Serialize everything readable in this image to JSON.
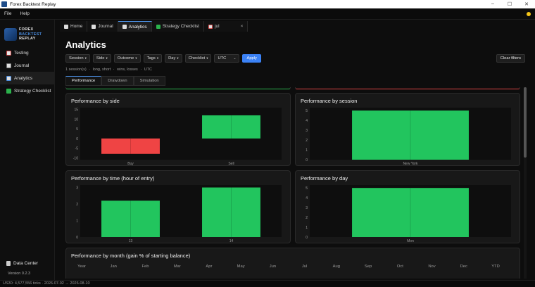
{
  "window": {
    "title": "Forex Backtest Replay",
    "controls": [
      "–",
      "☐",
      "✕"
    ]
  },
  "menu": {
    "items": [
      "File",
      "Help"
    ]
  },
  "brand": {
    "line1": "FOREX",
    "line2": "BACKTEST",
    "line3": "REPLAY"
  },
  "sidebar": {
    "items": [
      {
        "label": "Testing",
        "icon": "testing-icon"
      },
      {
        "label": "Journal",
        "icon": "journal-icon"
      },
      {
        "label": "Analytics",
        "icon": "analytics-icon",
        "active": true
      },
      {
        "label": "Strategy  Checklist",
        "icon": "checklist-icon"
      }
    ],
    "data_center": "Data Center",
    "version": "Version 0.2.3"
  },
  "tabs": [
    {
      "label": "Home",
      "icon": "home-icon"
    },
    {
      "label": "Journal",
      "icon": "journal-icon"
    },
    {
      "label": "Analytics",
      "icon": "analytics-icon",
      "active": true
    },
    {
      "label": "Strategy  Checklist",
      "icon": "checklist-icon"
    },
    {
      "label": "jul",
      "icon": "chart-icon",
      "close": "×"
    }
  ],
  "page": {
    "title": "Analytics",
    "filters": [
      "Session",
      "Side",
      "Outcome",
      "Tags",
      "Day",
      "Checklist"
    ],
    "timezone": "UTC",
    "apply": "Apply",
    "clear": "Clear filters",
    "summary": [
      "1 session(s)",
      "·",
      "long, short",
      "·",
      "wins, losses",
      "·",
      "UTC"
    ],
    "subtabs": [
      "Performance",
      "Drawdown",
      "Simulation"
    ]
  },
  "colors": {
    "positive": "#22c55e",
    "negative": "#ef4444",
    "accent": "#3b82f6"
  },
  "chart_data": [
    {
      "type": "bar",
      "title": "Performance by side",
      "categories": [
        "Buy",
        "Sell"
      ],
      "values": [
        -8,
        12
      ],
      "yticks": [
        15,
        10,
        5,
        0,
        -5,
        -10
      ],
      "ylim": [
        -11,
        16
      ]
    },
    {
      "type": "bar",
      "title": "Performance by session",
      "categories": [
        "New York"
      ],
      "values": [
        5
      ],
      "yticks": [
        5,
        4,
        3,
        2,
        1,
        0
      ],
      "ylim": [
        0,
        5.3
      ]
    },
    {
      "type": "bar",
      "title": "Performance by time (hour of entry)",
      "categories": [
        "13",
        "14"
      ],
      "values": [
        2.2,
        3
      ],
      "yticks": [
        3,
        2,
        1,
        0
      ],
      "ylim": [
        0,
        3.15
      ]
    },
    {
      "type": "bar",
      "title": "Performance by day",
      "categories": [
        "Mon"
      ],
      "values": [
        5
      ],
      "yticks": [
        5,
        4,
        3,
        2,
        1,
        0
      ],
      "ylim": [
        0,
        5.3
      ]
    },
    {
      "type": "table",
      "title": "Performance by month  (gain % of starting balance)",
      "columns": [
        "Year",
        "Jan",
        "Feb",
        "Mar",
        "Apr",
        "May",
        "Jun",
        "Jul",
        "Aug",
        "Sep",
        "Oct",
        "Nov",
        "Dec",
        "YTD"
      ]
    }
  ],
  "statusbar": {
    "text": "US30: 4,577,556 ticks · 2026-07-02 → 2026-08-10"
  }
}
